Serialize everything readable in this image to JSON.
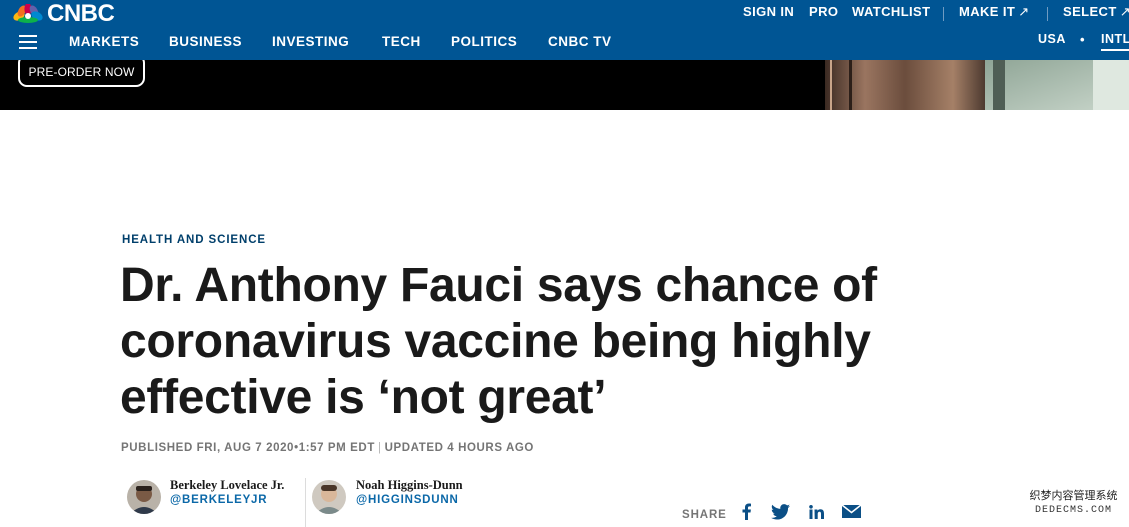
{
  "header": {
    "logo_text": "CNBC",
    "utility_nav": [
      {
        "label": "SIGN IN"
      },
      {
        "label": "PRO"
      },
      {
        "label": "WATCHLIST"
      },
      {
        "label": "MAKE IT"
      },
      {
        "label": "SELECT"
      }
    ],
    "main_nav": [
      "MARKETS",
      "BUSINESS",
      "INVESTING",
      "TECH",
      "POLITICS",
      "CNBC TV"
    ],
    "regions": {
      "usa": "USA",
      "intl": "INTL",
      "separator": "•"
    }
  },
  "ad": {
    "button_label": "PRE-ORDER NOW"
  },
  "article": {
    "section": "HEALTH AND SCIENCE",
    "headline": "Dr. Anthony Fauci says chance of coronavirus vaccine being highly effective is ‘not great’",
    "published": "PUBLISHED FRI, AUG 7 2020",
    "published_sep": "•",
    "published_time": "1:57 PM EDT",
    "updated_sep": "|",
    "updated": "UPDATED 4 HOURS AGO",
    "authors": [
      {
        "name": "Berkeley Lovelace Jr.",
        "handle": "@BERKELEYJR"
      },
      {
        "name": "Noah Higgins-Dunn",
        "handle": "@HIGGINSDUNN"
      }
    ],
    "share_label": "SHARE",
    "share_icons": [
      "facebook-icon",
      "twitter-icon",
      "linkedin-icon",
      "email-icon"
    ]
  },
  "watermark": {
    "line1": "织梦内容管理系统",
    "line2": "DEDECMS.COM"
  },
  "colors": {
    "header_bg": "#005594",
    "ad_bg": "#000000",
    "headline": "#1a1a1a",
    "section": "#003f6b",
    "handle": "#0b68a8",
    "meta": "#757575"
  }
}
